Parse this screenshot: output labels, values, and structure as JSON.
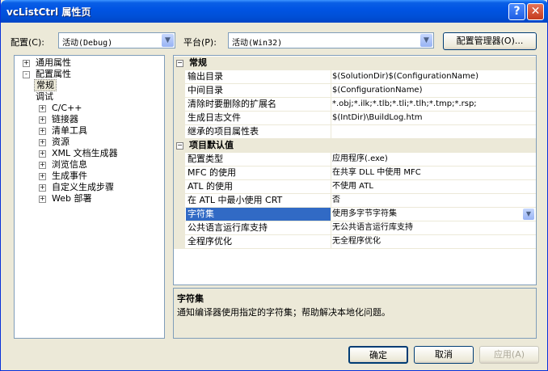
{
  "window": {
    "title": "vcListCtrl 属性页"
  },
  "titlebar": {
    "help_glyph": "?",
    "close_glyph": "✕"
  },
  "config": {
    "label": "配置(C):",
    "value": "活动(Debug)"
  },
  "platform": {
    "label": "平台(P):",
    "value": "活动(Win32)"
  },
  "config_manager_label": "配置管理器(O)...",
  "tree": [
    {
      "label": "通用属性",
      "expander": "+"
    },
    {
      "label": "配置属性",
      "expander": "-"
    },
    {
      "label": "常规",
      "expander": ""
    },
    {
      "label": "调试",
      "expander": ""
    },
    {
      "label": "C/C++",
      "expander": "+"
    },
    {
      "label": "链接器",
      "expander": "+"
    },
    {
      "label": "清单工具",
      "expander": "+"
    },
    {
      "label": "资源",
      "expander": "+"
    },
    {
      "label": "XML 文档生成器",
      "expander": "+"
    },
    {
      "label": "浏览信息",
      "expander": "+"
    },
    {
      "label": "生成事件",
      "expander": "+"
    },
    {
      "label": "自定义生成步骤",
      "expander": "+"
    },
    {
      "label": "Web 部署",
      "expander": "+"
    }
  ],
  "grid": {
    "categories": [
      {
        "name": "常规",
        "rows": [
          {
            "name": "输出目录",
            "value": "$(SolutionDir)$(ConfigurationName)"
          },
          {
            "name": "中间目录",
            "value": "$(ConfigurationName)"
          },
          {
            "name": "清除时要删除的扩展名",
            "value": "*.obj;*.ilk;*.tlb;*.tli;*.tlh;*.tmp;*.rsp;"
          },
          {
            "name": "生成日志文件",
            "value": "$(IntDir)\\BuildLog.htm"
          },
          {
            "name": "继承的项目属性表",
            "value": ""
          }
        ]
      },
      {
        "name": "项目默认值",
        "rows": [
          {
            "name": "配置类型",
            "value": "应用程序(.exe)"
          },
          {
            "name": "MFC 的使用",
            "value": "在共享 DLL 中使用 MFC"
          },
          {
            "name": "ATL 的使用",
            "value": "不使用 ATL"
          },
          {
            "name": "在 ATL 中最小使用 CRT",
            "value": "否"
          },
          {
            "name": "字符集",
            "value": "使用多字节字符集"
          },
          {
            "name": "公共语言运行库支持",
            "value": "无公共语言运行库支持"
          },
          {
            "name": "全程序优化",
            "value": "无全程序优化"
          }
        ]
      }
    ]
  },
  "description": {
    "title": "字符集",
    "text": "通知编译器使用指定的字符集；帮助解决本地化问题。"
  },
  "buttons": {
    "ok": "确定",
    "cancel": "取消",
    "apply": "应用(A)"
  },
  "colors": {
    "selection": "#316ac5",
    "titlebar": "#0054e3",
    "dialog_bg": "#ece9d8"
  }
}
